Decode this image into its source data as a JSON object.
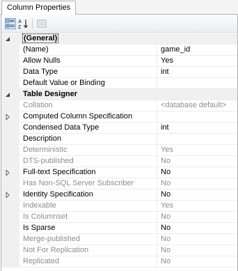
{
  "tab": {
    "label": "Column Properties"
  },
  "toolbar": {
    "categorized_icon": "categorized-icon",
    "alphabetical_icon": "alphabetical-sort-icon",
    "property_pages_icon": "property-pages-icon"
  },
  "rows": [
    {
      "kind": "category",
      "label": "(General)",
      "expand": "collapse"
    },
    {
      "label": "(Name)",
      "value": "game_id"
    },
    {
      "label": "Allow Nulls",
      "value": "Yes"
    },
    {
      "label": "Data Type",
      "value": "int"
    },
    {
      "label": "Default Value or Binding",
      "value": ""
    },
    {
      "kind": "category",
      "label": "Table Designer",
      "expand": "collapse"
    },
    {
      "label": "Collation",
      "value": "<database default>",
      "disabled": true
    },
    {
      "label": "Computed Column Specification",
      "value": "",
      "expand": "expand"
    },
    {
      "label": "Condensed Data Type",
      "value": "int"
    },
    {
      "label": "Description",
      "value": ""
    },
    {
      "label": "Deterministic",
      "value": "Yes",
      "disabled": true
    },
    {
      "label": "DTS-published",
      "value": "No",
      "disabled": true
    },
    {
      "label": "Full-text Specification",
      "value": "No",
      "expand": "expand"
    },
    {
      "label": "Has Non-SQL Server Subscriber",
      "value": "No",
      "disabled": true
    },
    {
      "label": "Identity Specification",
      "value": "No",
      "expand": "expand"
    },
    {
      "label": "Indexable",
      "value": "Yes",
      "disabled": true
    },
    {
      "label": "Is Columnset",
      "value": "No",
      "disabled": true
    },
    {
      "label": "Is Sparse",
      "value": "No"
    },
    {
      "label": "Merge-published",
      "value": "No",
      "disabled": true
    },
    {
      "label": "Not For Replication",
      "value": "No",
      "disabled": true
    },
    {
      "label": "Replicated",
      "value": "No",
      "disabled": true
    }
  ]
}
